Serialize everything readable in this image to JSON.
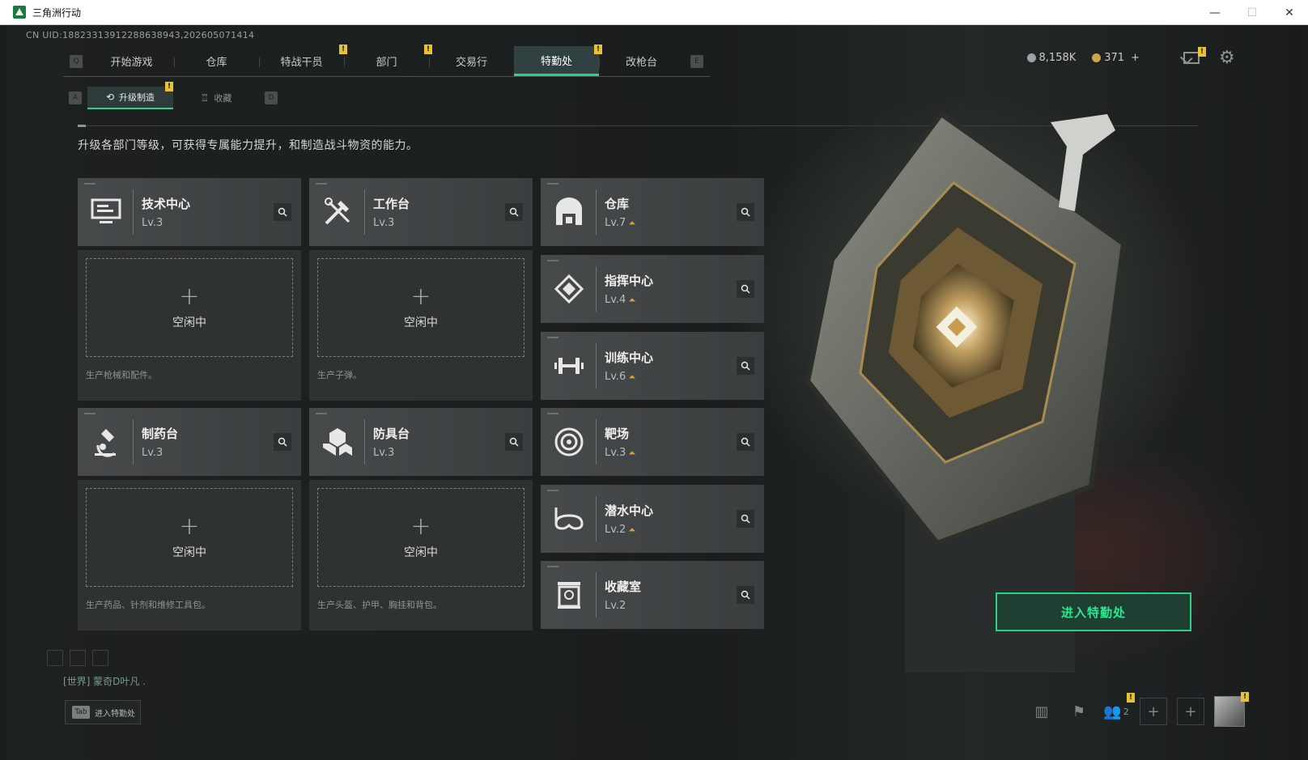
{
  "window": {
    "title": "三角洲行动",
    "controls": [
      "—",
      "☐",
      "✕"
    ]
  },
  "uid": "CN UID:18823313912288638943,202605071414",
  "nav": {
    "key_left": "Q",
    "key_right": "E",
    "tabs": [
      {
        "label": "开始游戏",
        "alert": false
      },
      {
        "label": "仓库",
        "alert": false
      },
      {
        "label": "特战干员",
        "alert": true
      },
      {
        "label": "部门",
        "alert": true
      },
      {
        "label": "交易行",
        "alert": false
      },
      {
        "label": "特勤处",
        "alert": true,
        "active": true
      },
      {
        "label": "改枪台",
        "alert": false
      }
    ]
  },
  "currency": {
    "silver": "8,158K",
    "gold": "371",
    "plus": "+"
  },
  "subnav": {
    "key_left": "A",
    "key_right": "D",
    "tabs": [
      {
        "label": "升级制造",
        "active": true,
        "icon": "upgrade-icon"
      },
      {
        "label": "收藏",
        "active": false,
        "icon": "trophy-icon"
      }
    ]
  },
  "description": "升级各部门等级，可获得专属能力提升，和制造战斗物资的能力。",
  "idle_label": "空闲中",
  "plus_symbol": "+",
  "alert_mark": "!",
  "stations": [
    {
      "name": "技术中心",
      "level": "Lv.3",
      "icon": "monitor-icon",
      "produce": "生产枪械和配件。",
      "upgradable": false
    },
    {
      "name": "工作台",
      "level": "Lv.3",
      "icon": "tools-icon",
      "produce": "生产子弹。",
      "upgradable": false
    },
    {
      "name": "制药台",
      "level": "Lv.3",
      "icon": "microscope-icon",
      "produce": "生产药品、针剂和维修工具包。",
      "upgradable": false
    },
    {
      "name": "防具台",
      "level": "Lv.3",
      "icon": "armor-icon",
      "produce": "生产头盔、护甲、胸挂和背包。",
      "upgradable": false
    }
  ],
  "departments": [
    {
      "name": "仓库",
      "level": "Lv.7",
      "icon": "warehouse-icon",
      "upgradable": true
    },
    {
      "name": "指挥中心",
      "level": "Lv.4",
      "icon": "command-icon",
      "upgradable": true
    },
    {
      "name": "训练中心",
      "level": "Lv.6",
      "icon": "dumbbell-icon",
      "upgradable": true
    },
    {
      "name": "靶场",
      "level": "Lv.3",
      "icon": "target-icon",
      "upgradable": true
    },
    {
      "name": "潜水中心",
      "level": "Lv.2",
      "icon": "diving-mask-icon",
      "upgradable": true
    },
    {
      "name": "收藏室",
      "level": "Lv.2",
      "icon": "collection-icon",
      "upgradable": false
    }
  ],
  "enter_button": "进入特勤处",
  "chat": "[世界] 蒙奇D叶凡 .",
  "tab_hint": {
    "key": "Tab",
    "label": "进入特勤处"
  },
  "friends_count": "2",
  "colors": {
    "accent": "#2dd18a",
    "alert": "#e8c235",
    "upgrade_arrow": "#d7a13c"
  }
}
